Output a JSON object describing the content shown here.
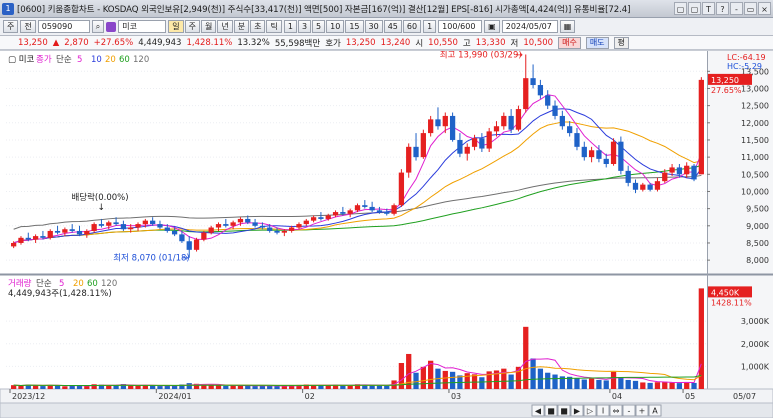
{
  "window": {
    "code": "[0600]",
    "title": "[0600] 키움종합차트 - KOSDAQ 외국인보유[2,949(천)] 주식수[33,417(천)] 액면[500] 자본금[167(억)] 결산[12월] EPS[-816] 시가총액[4,424(억)] 유통비율[72.4]",
    "badge": "1",
    "buttons": [
      "▢",
      "▢",
      "T",
      "?",
      "-",
      "▭",
      "×"
    ]
  },
  "toolbar": {
    "mode_label": "주",
    "type_label": "전",
    "stock_code": "059090",
    "stock_name": "미코",
    "periods": [
      "일",
      "주",
      "월",
      "년",
      "분",
      "초",
      "틱"
    ],
    "minutes": [
      "1",
      "3",
      "5",
      "10",
      "15",
      "30",
      "45",
      "60"
    ],
    "count_label": "1",
    "view_count": "100/600",
    "date": "2024/05/07"
  },
  "quote": {
    "price": "13,250",
    "arrow": "▲",
    "change": "2,870",
    "pct": "+27.65%",
    "volume": "4,449,943",
    "vol_pct": "1,428.11%",
    "rate": "13.32%",
    "amount": "55,598백만",
    "ask_label": "호가",
    "ask": "13,250",
    "bid": "13,240",
    "open_label": "시",
    "open": "10,550",
    "high_label": "고",
    "high": "13,330",
    "low_label": "저",
    "low": "10,500",
    "buy_btn": "매수",
    "sell_btn": "매도",
    "misc_btn": "평"
  },
  "chart_data": [
    {
      "type": "candlestick",
      "title": "미코",
      "legend": {
        "name": "종가",
        "ma_label": "단순",
        "ma_periods": [
          5,
          10,
          20,
          60,
          120
        ],
        "ma_colors": [
          "#e020d0",
          "#2b3cdc",
          "#f0a000",
          "#20a020",
          "#707070"
        ]
      },
      "ylim": [
        7800,
        13800
      ],
      "ticks": [
        "13,500",
        "13,000",
        "12,500",
        "12,000",
        "11,500",
        "11,000",
        "10,500",
        "10,000",
        "9,500",
        "9,000",
        "8,500",
        "8,000"
      ],
      "tick_values": [
        13500,
        13000,
        12500,
        12000,
        11500,
        11000,
        10500,
        10000,
        9500,
        9000,
        8500,
        8000
      ],
      "side_labels": {
        "lc": "LC:-64.19",
        "hc": "HC:-5.29",
        "last_price": "13,250",
        "last_pct": "27.65%"
      },
      "annotations": {
        "high": "최고 13,990 (03/29)",
        "low": "최저 8,070 (01/18)",
        "dividend": "배당락(0.00%)"
      },
      "colors": {
        "up": "#e52020",
        "down": "#1f62c7"
      },
      "candles": [
        [
          8400,
          8550,
          8350,
          8500
        ],
        [
          8500,
          8700,
          8450,
          8650
        ],
        [
          8650,
          8800,
          8550,
          8600
        ],
        [
          8600,
          8750,
          8500,
          8700
        ],
        [
          8700,
          8850,
          8600,
          8650
        ],
        [
          8650,
          8900,
          8600,
          8850
        ],
        [
          8850,
          9000,
          8750,
          8800
        ],
        [
          8800,
          8950,
          8700,
          8900
        ],
        [
          8900,
          9050,
          8800,
          8850
        ],
        [
          8850,
          9000,
          8700,
          8750
        ],
        [
          8750,
          8900,
          8650,
          8850
        ],
        [
          8850,
          9100,
          8800,
          9050
        ],
        [
          9050,
          9200,
          8950,
          9000
        ],
        [
          9000,
          9150,
          8900,
          9100
        ],
        [
          9100,
          9250,
          9000,
          9050
        ],
        [
          9050,
          9150,
          8850,
          8900
        ],
        [
          8900,
          9050,
          8800,
          8950
        ],
        [
          8950,
          9100,
          8850,
          9050
        ],
        [
          9050,
          9200,
          8950,
          9150
        ],
        [
          9150,
          9250,
          9000,
          9050
        ],
        [
          9050,
          9150,
          8900,
          8950
        ],
        [
          8950,
          9050,
          8800,
          8850
        ],
        [
          8850,
          8950,
          8700,
          8750
        ],
        [
          8750,
          8850,
          8500,
          8550
        ],
        [
          8550,
          8700,
          8070,
          8300
        ],
        [
          8300,
          8650,
          8250,
          8600
        ],
        [
          8600,
          8850,
          8550,
          8800
        ],
        [
          8800,
          9000,
          8750,
          8950
        ],
        [
          8950,
          9100,
          8850,
          9050
        ],
        [
          9050,
          9200,
          8950,
          9000
        ],
        [
          9000,
          9150,
          8900,
          9100
        ],
        [
          9100,
          9250,
          9000,
          9200
        ],
        [
          9200,
          9300,
          9050,
          9100
        ],
        [
          9100,
          9200,
          8950,
          9000
        ],
        [
          9000,
          9100,
          8900,
          8950
        ],
        [
          8950,
          9050,
          8800,
          8850
        ],
        [
          8850,
          8950,
          8750,
          8800
        ],
        [
          8800,
          8900,
          8700,
          8850
        ],
        [
          8850,
          9000,
          8800,
          8950
        ],
        [
          8950,
          9100,
          8900,
          9050
        ],
        [
          9050,
          9200,
          9000,
          9150
        ],
        [
          9150,
          9300,
          9100,
          9250
        ],
        [
          9250,
          9400,
          9150,
          9200
        ],
        [
          9200,
          9350,
          9150,
          9300
        ],
        [
          9300,
          9450,
          9250,
          9400
        ],
        [
          9400,
          9550,
          9300,
          9350
        ],
        [
          9350,
          9500,
          9250,
          9450
        ],
        [
          9450,
          9650,
          9400,
          9600
        ],
        [
          9600,
          9750,
          9500,
          9550
        ],
        [
          9550,
          9700,
          9400,
          9450
        ],
        [
          9450,
          9550,
          9350,
          9400
        ],
        [
          9400,
          9500,
          9300,
          9350
        ],
        [
          9350,
          9650,
          9300,
          9600
        ],
        [
          9600,
          10650,
          9550,
          10550
        ],
        [
          10550,
          11400,
          10400,
          11300
        ],
        [
          11300,
          11700,
          10900,
          11000
        ],
        [
          11000,
          11800,
          10950,
          11700
        ],
        [
          11700,
          12200,
          11600,
          12100
        ],
        [
          12100,
          12450,
          11800,
          11900
        ],
        [
          11900,
          12300,
          11700,
          12200
        ],
        [
          12200,
          12300,
          11450,
          11500
        ],
        [
          11500,
          11700,
          11000,
          11100
        ],
        [
          11100,
          11400,
          10900,
          11300
        ],
        [
          11300,
          11650,
          11200,
          11550
        ],
        [
          11550,
          11700,
          11150,
          11250
        ],
        [
          11250,
          11850,
          11150,
          11750
        ],
        [
          11750,
          12050,
          11600,
          11900
        ],
        [
          11900,
          12300,
          11800,
          12200
        ],
        [
          12200,
          12400,
          11700,
          11800
        ],
        [
          11800,
          12500,
          11750,
          12400
        ],
        [
          12400,
          13990,
          12300,
          13300
        ],
        [
          13300,
          13700,
          13000,
          13100
        ],
        [
          13100,
          13250,
          12700,
          12800
        ],
        [
          12800,
          12950,
          12400,
          12500
        ],
        [
          12500,
          12650,
          12100,
          12200
        ],
        [
          12200,
          12350,
          11800,
          11900
        ],
        [
          11900,
          12050,
          11600,
          11700
        ],
        [
          11700,
          11850,
          11200,
          11300
        ],
        [
          11300,
          11450,
          10900,
          11000
        ],
        [
          11000,
          11300,
          10850,
          11200
        ],
        [
          11200,
          11350,
          10850,
          10950
        ],
        [
          10950,
          11100,
          10700,
          10800
        ],
        [
          10800,
          11550,
          10750,
          11450
        ],
        [
          11450,
          11600,
          10500,
          10600
        ],
        [
          10600,
          10750,
          10150,
          10250
        ],
        [
          10250,
          10350,
          9950,
          10050
        ],
        [
          10050,
          10250,
          10000,
          10200
        ],
        [
          10200,
          10250,
          10000,
          10050
        ],
        [
          10050,
          10400,
          10000,
          10300
        ],
        [
          10300,
          10650,
          10250,
          10550
        ],
        [
          10550,
          10800,
          10450,
          10700
        ],
        [
          10700,
          10800,
          10400,
          10500
        ],
        [
          10500,
          10850,
          10400,
          10750
        ],
        [
          10750,
          10800,
          10300,
          10350
        ],
        [
          10500,
          13330,
          10500,
          13250
        ]
      ]
    },
    {
      "type": "bar",
      "title": "거래량",
      "legend": {
        "name": "거래량",
        "ma_label": "단순",
        "ma_periods": [
          5,
          20,
          60,
          120
        ]
      },
      "volume_text": "4,449,943주(1,428.11%)",
      "ylim": [
        0,
        4600
      ],
      "ticks": [
        "3,000K",
        "2,000K",
        "1,000K"
      ],
      "tick_values": [
        3000,
        2000,
        1000
      ],
      "side_labels": {
        "last": "4,450K",
        "last_pct": "1428.11%"
      },
      "values_k": [
        170,
        140,
        200,
        160,
        130,
        180,
        150,
        120,
        160,
        140,
        130,
        210,
        190,
        150,
        170,
        220,
        150,
        140,
        170,
        160,
        130,
        150,
        140,
        200,
        260,
        230,
        190,
        160,
        170,
        140,
        150,
        160,
        140,
        130,
        150,
        140,
        130,
        120,
        160,
        180,
        200,
        170,
        160,
        150,
        190,
        170,
        160,
        210,
        180,
        160,
        150,
        140,
        380,
        1150,
        1550,
        720,
        980,
        1250,
        900,
        800,
        760,
        600,
        700,
        650,
        520,
        780,
        820,
        900,
        640,
        980,
        2750,
        1350,
        900,
        720,
        640,
        560,
        540,
        480,
        420,
        460,
        400,
        380,
        760,
        520,
        400,
        360,
        290,
        270,
        300,
        320,
        280,
        260,
        300,
        270,
        4450
      ]
    }
  ],
  "xaxis": {
    "labels": [
      "2023/12",
      "2024/01",
      "02",
      "03",
      "04",
      "05"
    ],
    "end_label": "05/07"
  },
  "bottom_controls": [
    "◀",
    "■",
    "■",
    "▶",
    "▷",
    "I",
    "⇔",
    "-",
    "+",
    "A"
  ]
}
